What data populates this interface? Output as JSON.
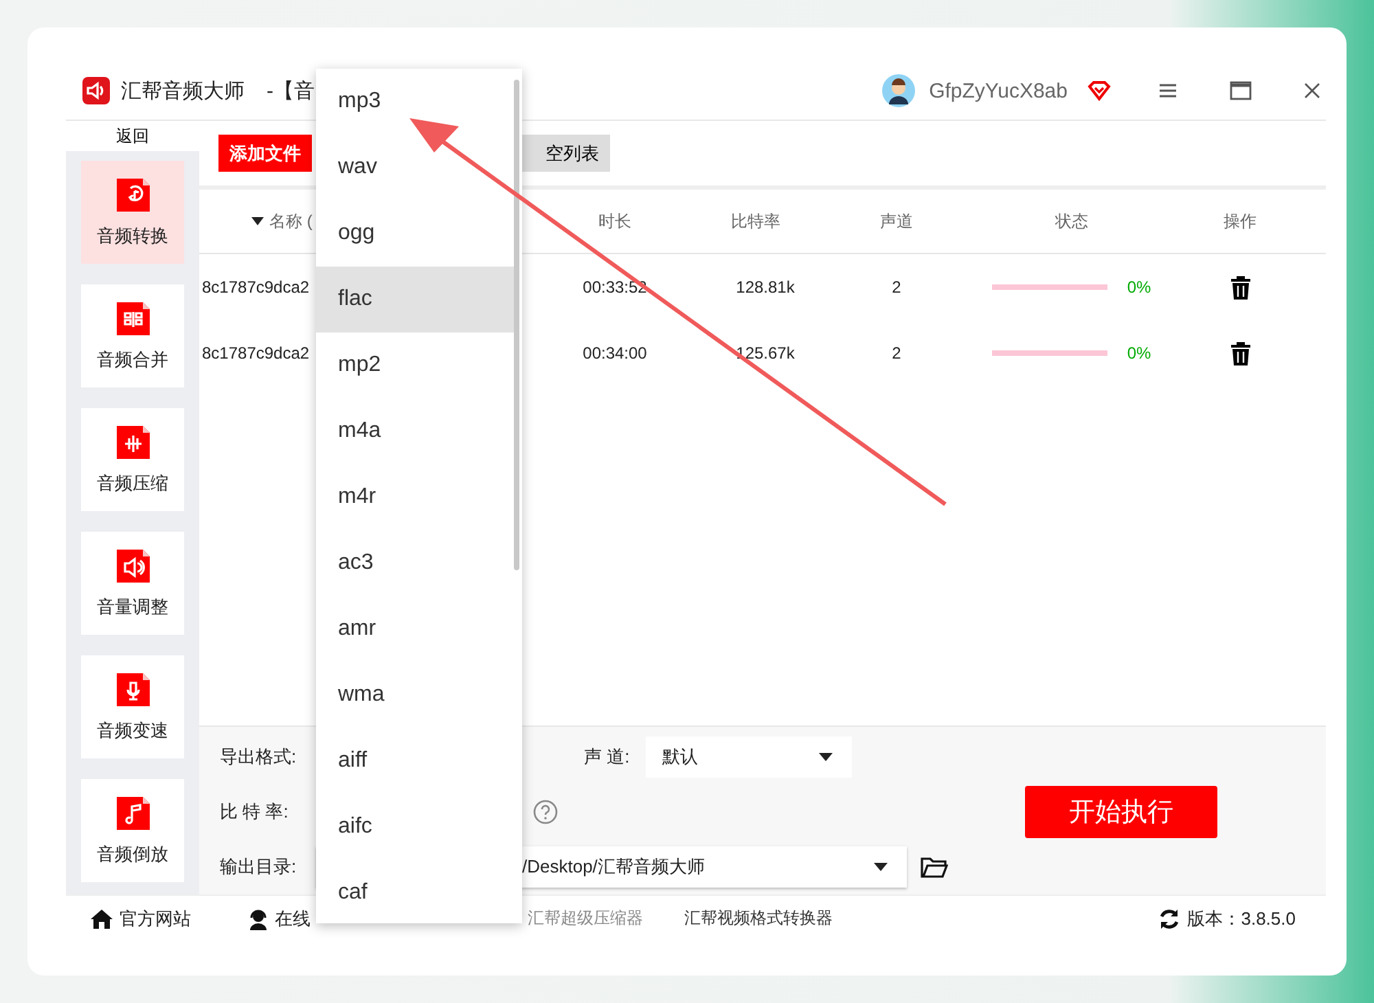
{
  "window": {
    "title": "汇帮音频大师",
    "title_suffix": "-【音",
    "user": "GfpZyYucX8ab"
  },
  "sidebar": {
    "back": "返回",
    "items": [
      {
        "label": "音频转换",
        "kind": "convert",
        "selected": true
      },
      {
        "label": "音频合并",
        "kind": "merge",
        "selected": false
      },
      {
        "label": "音频压缩",
        "kind": "compress",
        "selected": false
      },
      {
        "label": "音量调整",
        "kind": "volume",
        "selected": false
      },
      {
        "label": "音频变速",
        "kind": "mic",
        "selected": false
      },
      {
        "label": "音频倒放",
        "kind": "note",
        "selected": false
      }
    ]
  },
  "toolbar": {
    "add": "添加文件",
    "clear": "空列表"
  },
  "table": {
    "columns": [
      "名称 (",
      "时长",
      "比特率",
      "声道",
      "状态",
      "操作"
    ],
    "rows": [
      {
        "name": "8c1787c9dca2",
        "duration": "00:33:52",
        "bitrate": "128.81k",
        "channels": "2",
        "level": 0,
        "progress": "0%"
      },
      {
        "name": "8c1787c9dca2",
        "duration": "00:34:00",
        "bitrate": "125.67k",
        "channels": "2",
        "level": 0,
        "progress": "0%"
      }
    ]
  },
  "settings": {
    "format_label": "导出格式:",
    "bitrate_label": "比 特 率:",
    "output_label": "输出目录:",
    "output_path": "/Desktop/汇帮音频大师",
    "channel_label": "声 道:",
    "channel_value": "默认",
    "start": "开始执行"
  },
  "footer": {
    "website": "官方网站",
    "service": "在线",
    "links": [
      "汇帮超级压缩器",
      "汇帮视频格式转换器"
    ],
    "version": "版本：3.8.5.0"
  },
  "format_menu": [
    {
      "label": "mp3",
      "selected": false
    },
    {
      "label": "wav",
      "selected": false
    },
    {
      "label": "ogg",
      "selected": false
    },
    {
      "label": "flac",
      "selected": true
    },
    {
      "label": "mp2",
      "selected": false
    },
    {
      "label": "m4a",
      "selected": false
    },
    {
      "label": "m4r",
      "selected": false
    },
    {
      "label": "ac3",
      "selected": false
    },
    {
      "label": "amr",
      "selected": false
    },
    {
      "label": "wma",
      "selected": false
    },
    {
      "label": "aiff",
      "selected": false
    },
    {
      "label": "aifc",
      "selected": false
    },
    {
      "label": "caf",
      "selected": false
    }
  ]
}
